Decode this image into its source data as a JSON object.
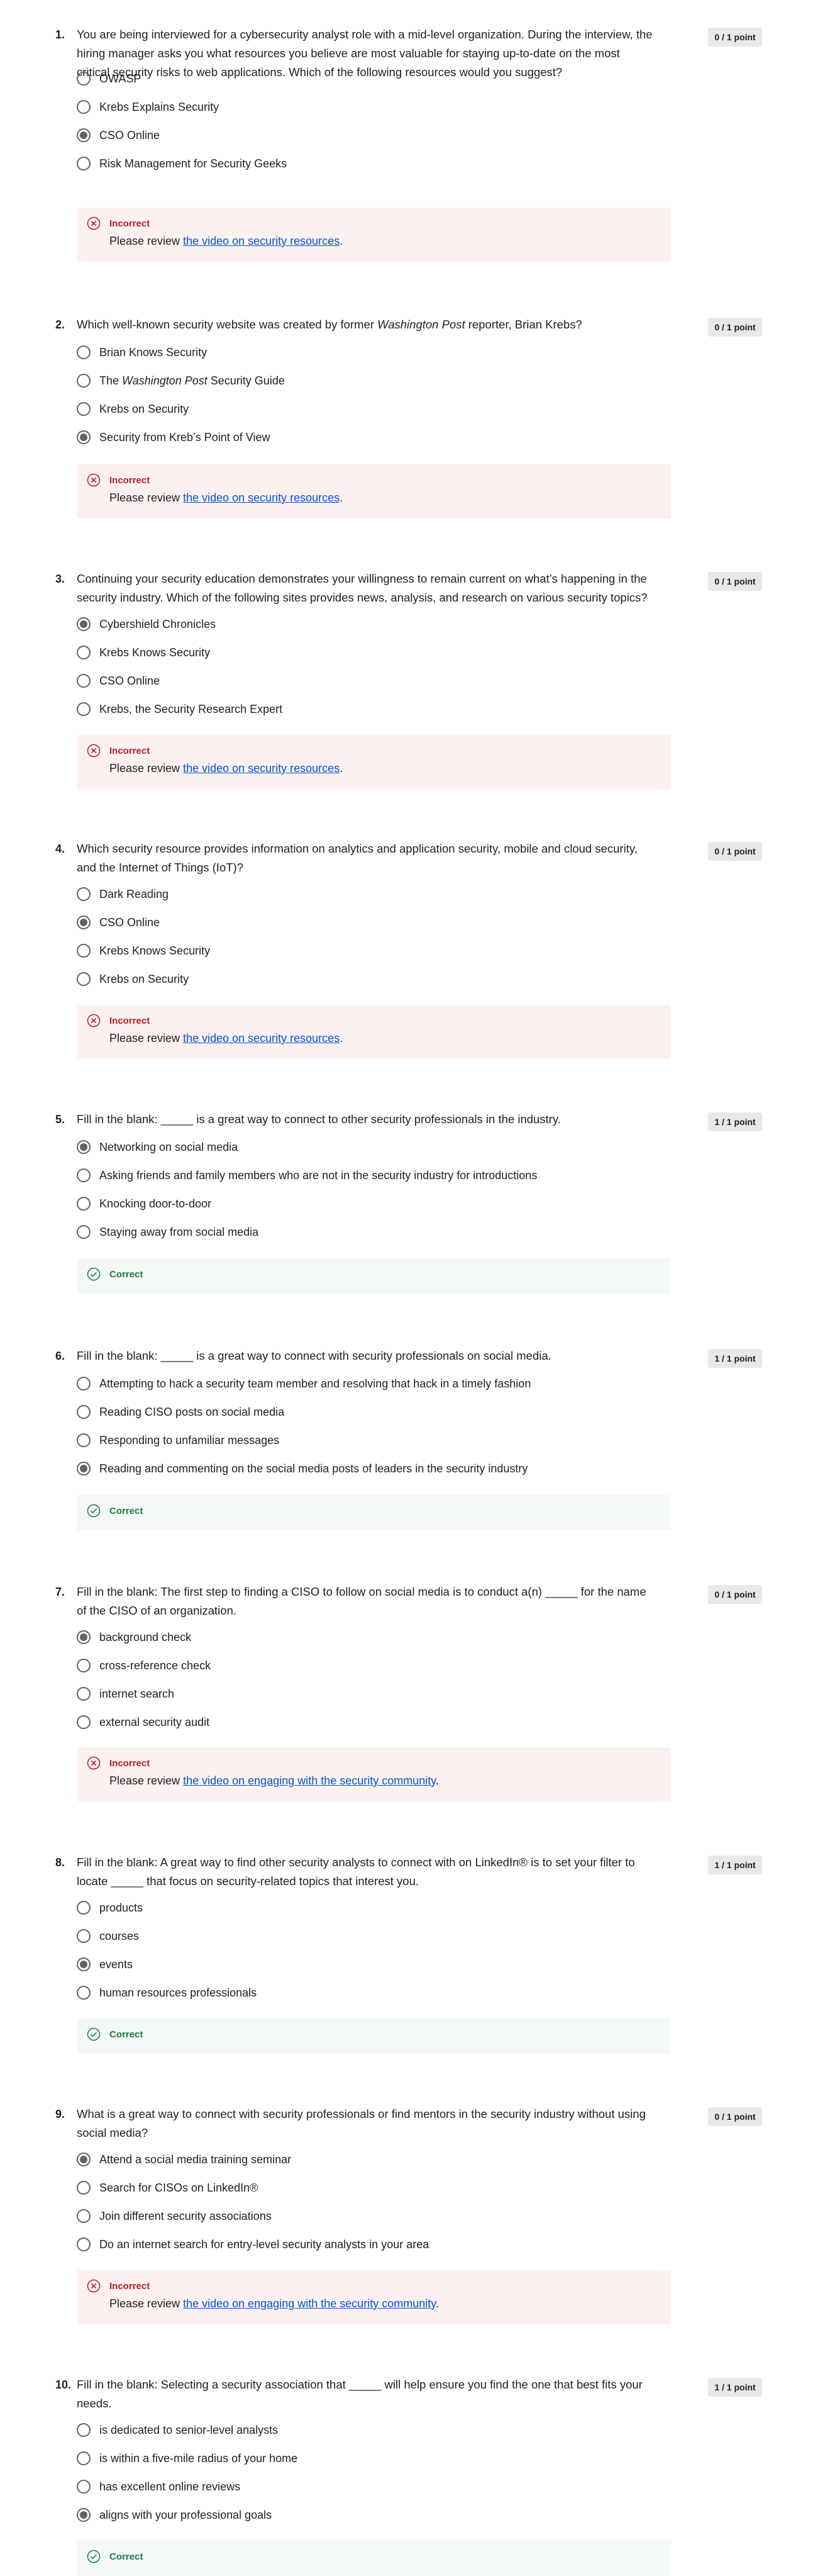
{
  "colors": {
    "incorrect": "#b41e26",
    "correct": "#1e7a45",
    "link": "#0056d2",
    "incorrect_bg": "#fdf0f1",
    "correct_bg": "#f4f8f6"
  },
  "questions": [
    {
      "number": "1.",
      "text": "You are being interviewed for a cybersecurity analyst role with a mid-level organization. During the interview, the hiring manager asks you what resources you believe are most valuable for staying up-to-date on the most critical security risks to web applications. Which of the following resources would you suggest?",
      "points": "0 / 1 point",
      "options": [
        {
          "label": "OWASP",
          "selected": false
        },
        {
          "label": "Krebs Explains Security",
          "selected": false
        },
        {
          "label": "CSO Online",
          "selected": true
        },
        {
          "label": "Risk Management for Security Geeks",
          "selected": false
        }
      ],
      "feedback": {
        "status": "Incorrect",
        "review_prefix": "Please review ",
        "review_link": "the video on security resources",
        "review_suffix": "."
      }
    },
    {
      "number": "2.",
      "text": "Which well-known security website was created by former Washington Post reporter, Brian Krebs?",
      "points": "0 / 1 point",
      "options": [
        {
          "label": "Brian Knows Security",
          "selected": false
        },
        {
          "label": "The Washington Post Security Guide",
          "selected": false
        },
        {
          "label": "Krebs on Security",
          "selected": false
        },
        {
          "label": "Security from Kreb’s Point of View",
          "selected": true
        }
      ],
      "feedback": {
        "status": "Incorrect",
        "review_prefix": "Please review ",
        "review_link": "the video on security resources",
        "review_suffix": "."
      }
    },
    {
      "number": "3.",
      "text": "Continuing your security education demonstrates your willingness to remain current on what’s happening in the security industry. Which of the following sites provides news, analysis, and research on various security topics?",
      "points": "0 / 1 point",
      "options": [
        {
          "label": "Cybershield Chronicles",
          "selected": true
        },
        {
          "label": "Krebs Knows Security",
          "selected": false
        },
        {
          "label": "CSO Online",
          "selected": false
        },
        {
          "label": "Krebs, the Security Research Expert",
          "selected": false
        }
      ],
      "feedback": {
        "status": "Incorrect",
        "review_prefix": "Please review ",
        "review_link": "the video on security resources",
        "review_suffix": "."
      }
    },
    {
      "number": "4.",
      "text": "Which security resource provides information on analytics and application security, mobile and cloud security, and the Internet of Things (IoT)?",
      "points": "0 / 1 point",
      "options": [
        {
          "label": "Dark Reading",
          "selected": false
        },
        {
          "label": "CSO Online",
          "selected": true
        },
        {
          "label": "Krebs Knows Security",
          "selected": false
        },
        {
          "label": "Krebs on Security",
          "selected": false
        }
      ],
      "feedback": {
        "status": "Incorrect",
        "review_prefix": "Please review ",
        "review_link": "the video on security resources",
        "review_suffix": "."
      }
    },
    {
      "number": "5.",
      "text": "Fill in the blank: _____ is a great way to connect to other security professionals in the industry.",
      "points": "1 / 1 point",
      "options": [
        {
          "label": "Networking on social media",
          "selected": true
        },
        {
          "label": "Asking friends and family members who are not in the security industry for introductions",
          "selected": false
        },
        {
          "label": "Knocking door-to-door",
          "selected": false
        },
        {
          "label": "Staying away from social media",
          "selected": false
        }
      ],
      "feedback": {
        "status": "Correct"
      }
    },
    {
      "number": "6.",
      "text": "Fill in the blank: _____  is a great way to connect with security professionals on social media.",
      "points": "1 / 1 point",
      "options": [
        {
          "label": "Attempting to hack a security team member and resolving that hack in a timely fashion",
          "selected": false
        },
        {
          "label": "Reading CISO posts on social media",
          "selected": false
        },
        {
          "label": "Responding to unfamiliar messages",
          "selected": false
        },
        {
          "label": "Reading and commenting on the social media posts of leaders in the security industry",
          "selected": true
        }
      ],
      "feedback": {
        "status": "Correct"
      }
    },
    {
      "number": "7.",
      "text": "Fill in the blank: The first step to finding a CISO to follow on social media is to conduct a(n) _____ for the name of the CISO of an organization.",
      "points": "0 / 1 point",
      "options": [
        {
          "label": "background check",
          "selected": true
        },
        {
          "label": "cross-reference check",
          "selected": false
        },
        {
          "label": "internet search",
          "selected": false
        },
        {
          "label": "external security audit",
          "selected": false
        }
      ],
      "feedback": {
        "status": "Incorrect",
        "review_prefix": "Please review ",
        "review_link": "the video on engaging with the security community",
        "review_suffix": "."
      }
    },
    {
      "number": "8.",
      "text": "Fill in the blank: A great way to find other security analysts to connect with on LinkedIn® is to set your filter to locate _____ that focus on security-related topics that interest you.",
      "points": "1 / 1 point",
      "options": [
        {
          "label": "products",
          "selected": false
        },
        {
          "label": "courses",
          "selected": false
        },
        {
          "label": "events",
          "selected": true
        },
        {
          "label": "human resources professionals",
          "selected": false
        }
      ],
      "feedback": {
        "status": "Correct"
      }
    },
    {
      "number": "9.",
      "text": "What is a great way to connect with security professionals or find mentors in the security industry without using social media?",
      "points": "0 / 1 point",
      "options": [
        {
          "label": "Attend a social media training seminar",
          "selected": true
        },
        {
          "label": "Search for CISOs on LinkedIn®",
          "selected": false
        },
        {
          "label": "Join different security associations",
          "selected": false
        },
        {
          "label": "Do an internet search for entry-level security analysts in your area",
          "selected": false
        }
      ],
      "feedback": {
        "status": "Incorrect",
        "review_prefix": "Please review ",
        "review_link": "the video on engaging with the security community",
        "review_suffix": "."
      }
    },
    {
      "number": "10.",
      "text": "Fill in the blank: Selecting a security association that _____ will help ensure you find the one that best fits your needs.",
      "points": "1 / 1 point",
      "options": [
        {
          "label": "is dedicated to senior-level analysts",
          "selected": false
        },
        {
          "label": "is within a five-mile radius of your home",
          "selected": false
        },
        {
          "label": "has excellent online reviews",
          "selected": false
        },
        {
          "label": "aligns with your professional goals",
          "selected": true
        }
      ],
      "feedback": {
        "status": "Correct"
      }
    }
  ]
}
